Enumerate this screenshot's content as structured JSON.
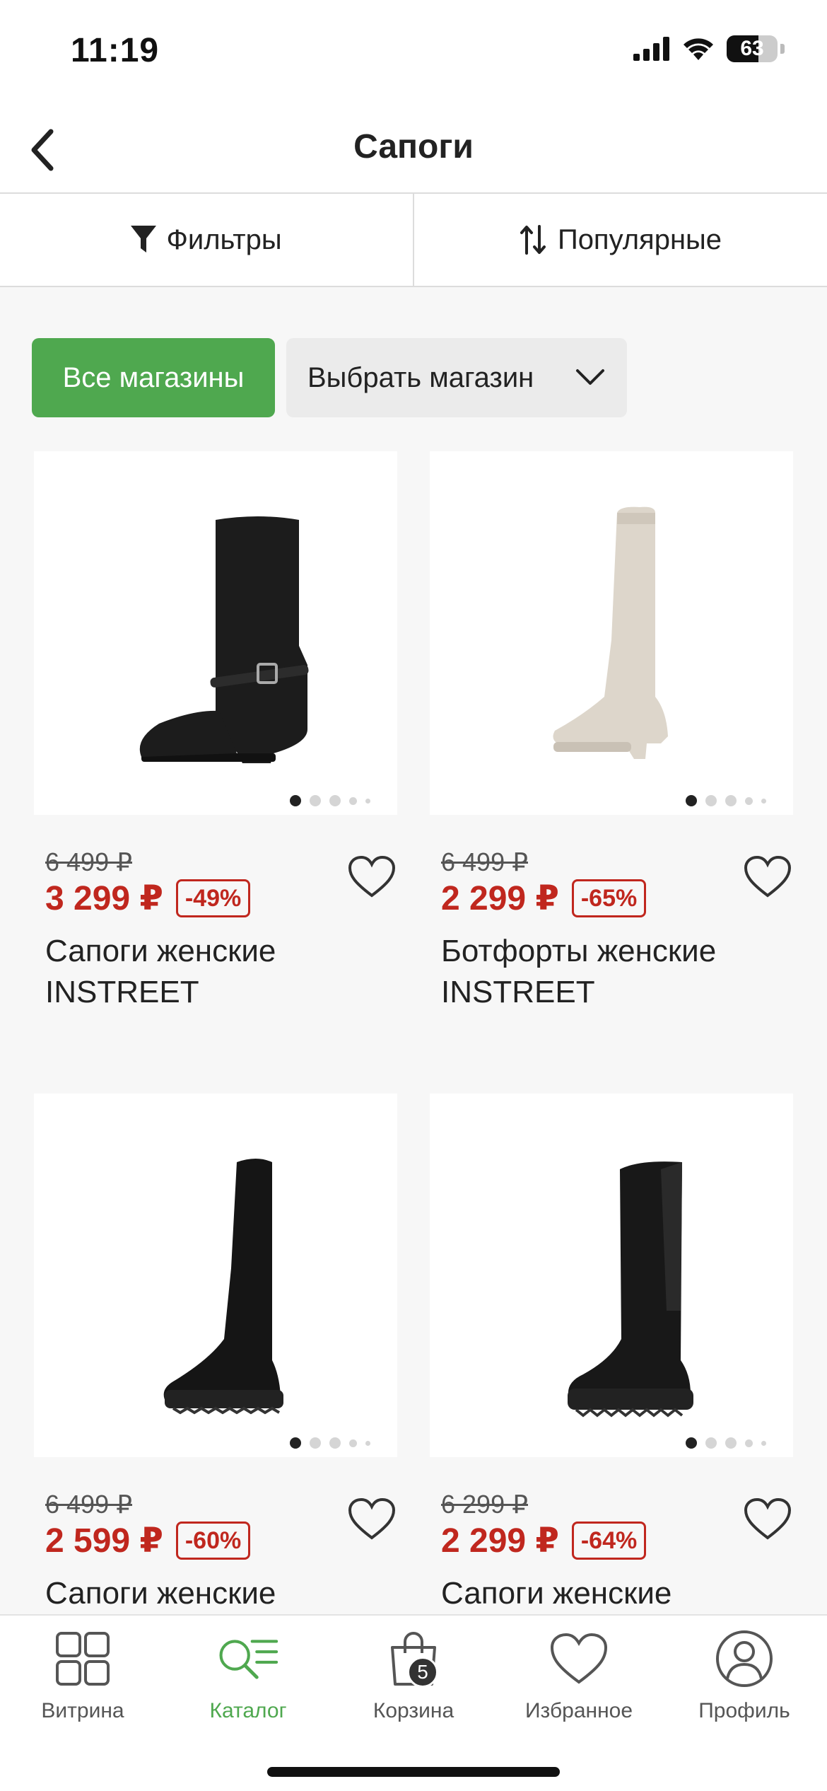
{
  "status_bar": {
    "time": "11:19",
    "battery": "63",
    "battery_level": 0.63
  },
  "header": {
    "title": "Сапоги"
  },
  "toolbar": {
    "filters_label": "Фильтры",
    "sort_label": "Популярные"
  },
  "stores": {
    "all_label": "Все магазины",
    "select_label": "Выбрать магазин"
  },
  "products": [
    {
      "old_price": "6 499 ₽",
      "price": "3 299 ₽",
      "discount": "-49%",
      "title": "Сапоги женские INSTREET",
      "image": "black-leather-boot",
      "boot_color": "#1c1c1c"
    },
    {
      "old_price": "6 499 ₽",
      "price": "2 299 ₽",
      "discount": "-65%",
      "title": "Ботфорты женские INSTREET",
      "image": "beige-over-knee-boot",
      "boot_color": "#ddd6cb"
    },
    {
      "old_price": "6 499 ₽",
      "price": "2 599 ₽",
      "discount": "-60%",
      "title": "Сапоги женские",
      "image": "black-suede-over-knee-boot",
      "boot_color": "#151515"
    },
    {
      "old_price": "6 299 ₽",
      "price": "2 299 ₽",
      "discount": "-64%",
      "title": "Сапоги женские",
      "image": "black-chunky-boot",
      "boot_color": "#181818"
    }
  ],
  "nav": [
    {
      "label": "Витрина",
      "icon": "grid-icon"
    },
    {
      "label": "Каталог",
      "icon": "catalog-search-icon"
    },
    {
      "label": "Корзина",
      "icon": "bag-icon",
      "badge": "5"
    },
    {
      "label": "Избранное",
      "icon": "heart-icon"
    },
    {
      "label": "Профиль",
      "icon": "profile-icon"
    }
  ],
  "colors": {
    "accent": "#4fa84f",
    "price_red": "#c0271e"
  }
}
